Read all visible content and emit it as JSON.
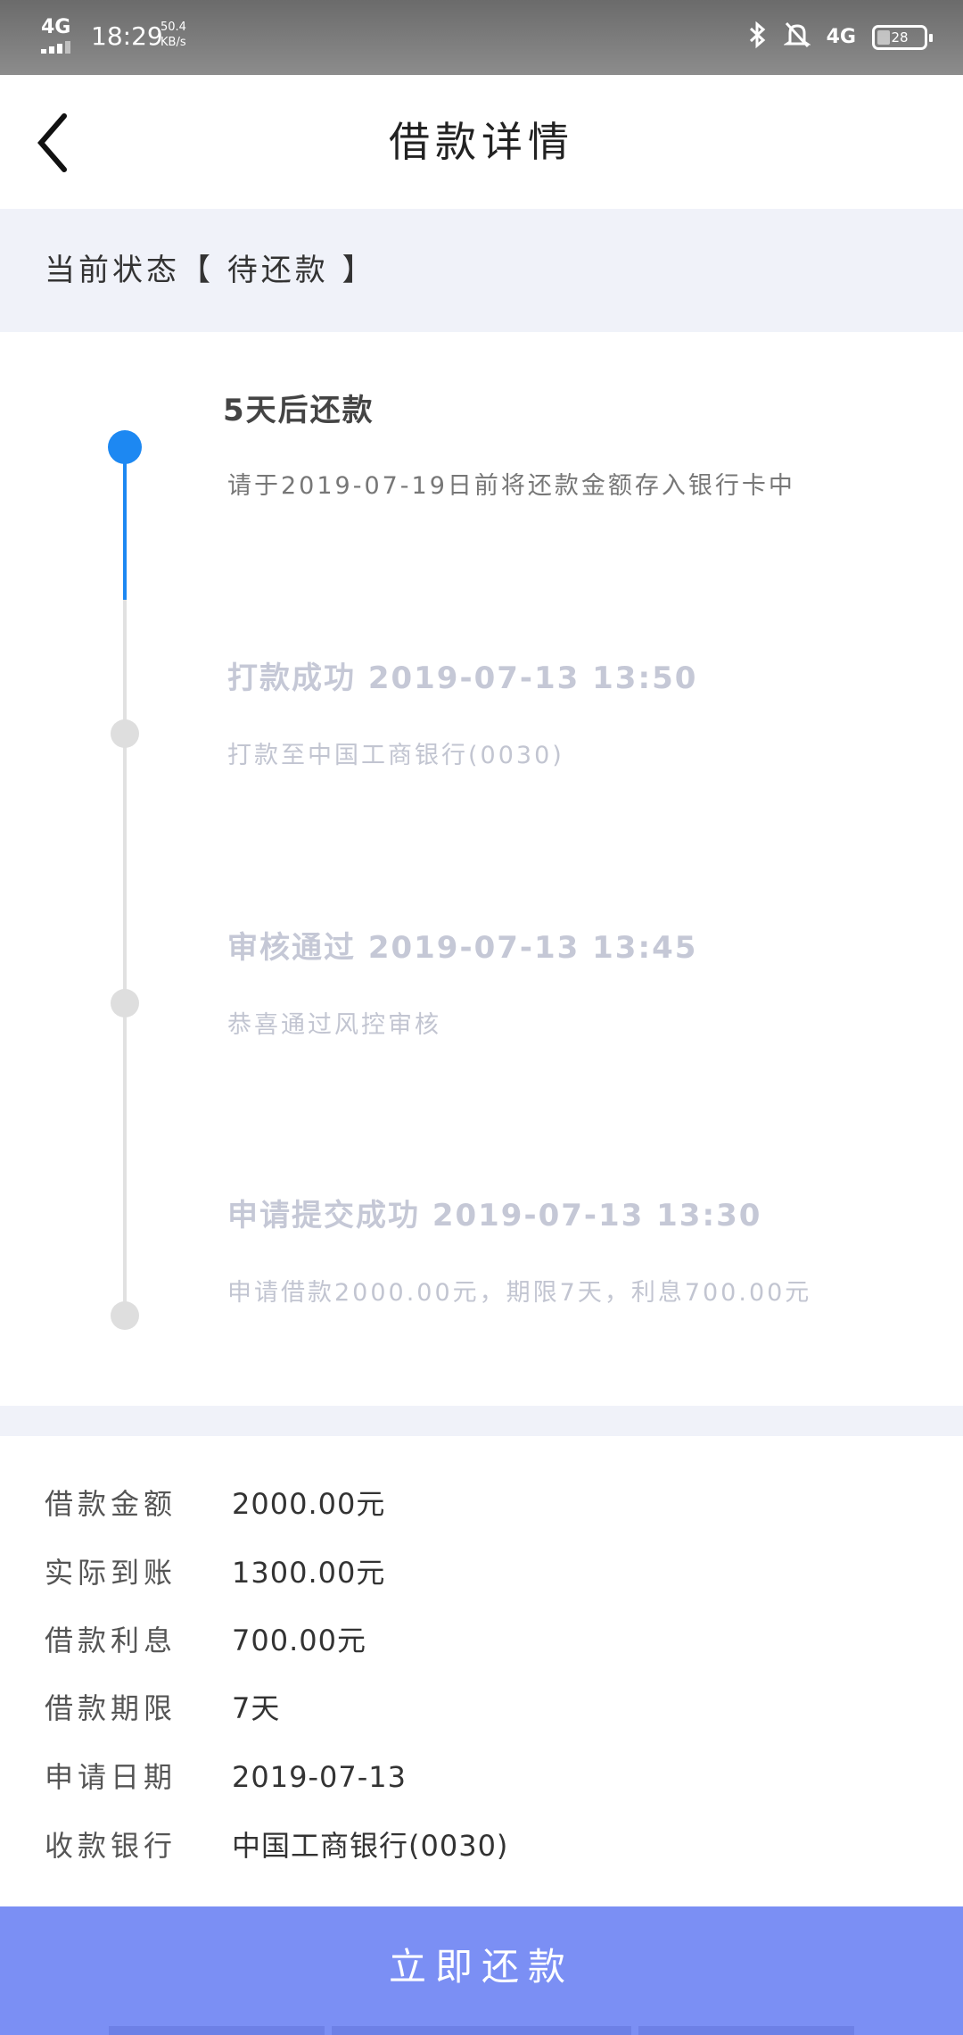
{
  "status_bar": {
    "network": "4G",
    "time": "18:29",
    "speed_value": "50.4",
    "speed_unit": "KB/s",
    "network_right": "4G",
    "battery": "28"
  },
  "nav": {
    "title": "借款详情"
  },
  "status": {
    "text": "当前状态【 待还款 】"
  },
  "timeline": [
    {
      "title": "5天后还款",
      "desc": "请于2019-07-19日前将还款金额存入银行卡中"
    },
    {
      "title": "打款成功 2019-07-13 13:50",
      "desc": "打款至中国工商银行(0030)"
    },
    {
      "title": "审核通过 2019-07-13 13:45",
      "desc": "恭喜通过风控审核"
    },
    {
      "title": "申请提交成功 2019-07-13 13:30",
      "desc": "申请借款2000.00元，期限7天，利息700.00元"
    }
  ],
  "details": [
    {
      "label": "借款金额",
      "value": "2000.00元"
    },
    {
      "label": "实际到账",
      "value": "1300.00元"
    },
    {
      "label": "借款利息",
      "value": "700.00元"
    },
    {
      "label": "借款期限",
      "value": "7天"
    },
    {
      "label": "申请日期",
      "value": "2019-07-13"
    },
    {
      "label": "收款银行",
      "value": "中国工商银行(0030)"
    }
  ],
  "action": {
    "repay_label": "立即还款"
  },
  "colors": {
    "accent": "#1d88f2",
    "button": "#7b8ff4",
    "strip": "#f0f2f9"
  }
}
